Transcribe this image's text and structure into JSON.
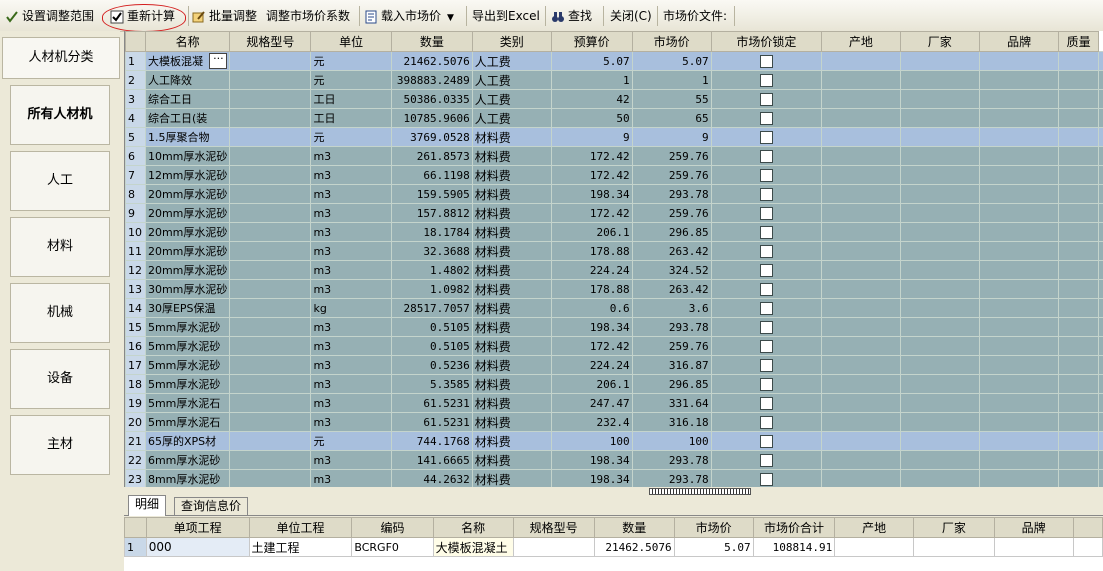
{
  "toolbar": {
    "set_range": "设置调整范围",
    "recalc": "重新计算",
    "batch_adjust": "批量调整",
    "adjust_coef": "调整市场价系数",
    "load_price": "载入市场价",
    "export_excel": "导出到Excel",
    "find": "查找",
    "close": "关闭(C)",
    "price_file": "市场价文件:"
  },
  "left": {
    "title": "人材机分类",
    "categories": [
      "所有人材机",
      "人工",
      "材料",
      "机械",
      "设备",
      "主材"
    ]
  },
  "grid": {
    "headers": [
      "名称",
      "规格型号",
      "单位",
      "数量",
      "类别",
      "预算价",
      "市场价",
      "市场价锁定",
      "产地",
      "厂家",
      "品牌",
      "质量"
    ],
    "rows": [
      {
        "n": "1",
        "name": "大模板混凝",
        "spec": "",
        "unit": "元",
        "qty": "21462.5076",
        "cat": "人工费",
        "budget": "5.07",
        "market": "5.07"
      },
      {
        "n": "2",
        "name": "人工降效",
        "spec": "",
        "unit": "元",
        "qty": "398883.2489",
        "cat": "人工费",
        "budget": "1",
        "market": "1"
      },
      {
        "n": "3",
        "name": "综合工日",
        "spec": "",
        "unit": "工日",
        "qty": "50386.0335",
        "cat": "人工费",
        "budget": "42",
        "market": "55"
      },
      {
        "n": "4",
        "name": "综合工日(装",
        "spec": "",
        "unit": "工日",
        "qty": "10785.9606",
        "cat": "人工费",
        "budget": "50",
        "market": "65"
      },
      {
        "n": "5",
        "name": "1.5厚聚合物",
        "spec": "",
        "unit": "元",
        "qty": "3769.0528",
        "cat": "材料费",
        "budget": "9",
        "market": "9"
      },
      {
        "n": "6",
        "name": "10mm厚水泥砂",
        "spec": "",
        "unit": "m3",
        "qty": "261.8573",
        "cat": "材料费",
        "budget": "172.42",
        "market": "259.76"
      },
      {
        "n": "7",
        "name": "12mm厚水泥砂",
        "spec": "",
        "unit": "m3",
        "qty": "66.1198",
        "cat": "材料费",
        "budget": "172.42",
        "market": "259.76"
      },
      {
        "n": "8",
        "name": "20mm厚水泥砂",
        "spec": "",
        "unit": "m3",
        "qty": "159.5905",
        "cat": "材料费",
        "budget": "198.34",
        "market": "293.78"
      },
      {
        "n": "9",
        "name": "20mm厚水泥砂",
        "spec": "",
        "unit": "m3",
        "qty": "157.8812",
        "cat": "材料费",
        "budget": "172.42",
        "market": "259.76"
      },
      {
        "n": "10",
        "name": "20mm厚水泥砂",
        "spec": "",
        "unit": "m3",
        "qty": "18.1784",
        "cat": "材料费",
        "budget": "206.1",
        "market": "296.85"
      },
      {
        "n": "11",
        "name": "20mm厚水泥砂",
        "spec": "",
        "unit": "m3",
        "qty": "32.3688",
        "cat": "材料费",
        "budget": "178.88",
        "market": "263.42"
      },
      {
        "n": "12",
        "name": "20mm厚水泥砂",
        "spec": "",
        "unit": "m3",
        "qty": "1.4802",
        "cat": "材料费",
        "budget": "224.24",
        "market": "324.52"
      },
      {
        "n": "13",
        "name": "30mm厚水泥砂",
        "spec": "",
        "unit": "m3",
        "qty": "1.0982",
        "cat": "材料费",
        "budget": "178.88",
        "market": "263.42"
      },
      {
        "n": "14",
        "name": "30厚EPS保温",
        "spec": "",
        "unit": "kg",
        "qty": "28517.7057",
        "cat": "材料费",
        "budget": "0.6",
        "market": "3.6"
      },
      {
        "n": "15",
        "name": "5mm厚水泥砂",
        "spec": "",
        "unit": "m3",
        "qty": "0.5105",
        "cat": "材料费",
        "budget": "198.34",
        "market": "293.78"
      },
      {
        "n": "16",
        "name": "5mm厚水泥砂",
        "spec": "",
        "unit": "m3",
        "qty": "0.5105",
        "cat": "材料费",
        "budget": "172.42",
        "market": "259.76"
      },
      {
        "n": "17",
        "name": "5mm厚水泥砂",
        "spec": "",
        "unit": "m3",
        "qty": "0.5236",
        "cat": "材料费",
        "budget": "224.24",
        "market": "316.87"
      },
      {
        "n": "18",
        "name": "5mm厚水泥砂",
        "spec": "",
        "unit": "m3",
        "qty": "5.3585",
        "cat": "材料费",
        "budget": "206.1",
        "market": "296.85"
      },
      {
        "n": "19",
        "name": "5mm厚水泥石",
        "spec": "",
        "unit": "m3",
        "qty": "61.5231",
        "cat": "材料费",
        "budget": "247.47",
        "market": "331.64"
      },
      {
        "n": "20",
        "name": "5mm厚水泥石",
        "spec": "",
        "unit": "m3",
        "qty": "61.5231",
        "cat": "材料费",
        "budget": "232.4",
        "market": "316.18"
      },
      {
        "n": "21",
        "name": "65厚的XPS材",
        "spec": "",
        "unit": "元",
        "qty": "744.1768",
        "cat": "材料费",
        "budget": "100",
        "market": "100"
      },
      {
        "n": "22",
        "name": "6mm厚水泥砂",
        "spec": "",
        "unit": "m3",
        "qty": "141.6665",
        "cat": "材料费",
        "budget": "198.34",
        "market": "293.78"
      },
      {
        "n": "23",
        "name": "8mm厚水泥砂",
        "spec": "",
        "unit": "m3",
        "qty": "44.2632",
        "cat": "材料费",
        "budget": "198.34",
        "market": "293.78"
      }
    ]
  },
  "bottom": {
    "tabs": [
      "明细",
      "查询信息价"
    ],
    "headers": [
      "单项工程",
      "单位工程",
      "编码",
      "名称",
      "规格型号",
      "数量",
      "市场价",
      "市场价合计",
      "产地",
      "厂家",
      "品牌"
    ],
    "row": {
      "n": "1",
      "single": "000",
      "unit_proj": "土建工程",
      "code": "BCRGF0",
      "name": "大模板混凝土",
      "spec": "",
      "qty": "21462.5076",
      "price": "5.07",
      "total": "108814.91"
    }
  }
}
